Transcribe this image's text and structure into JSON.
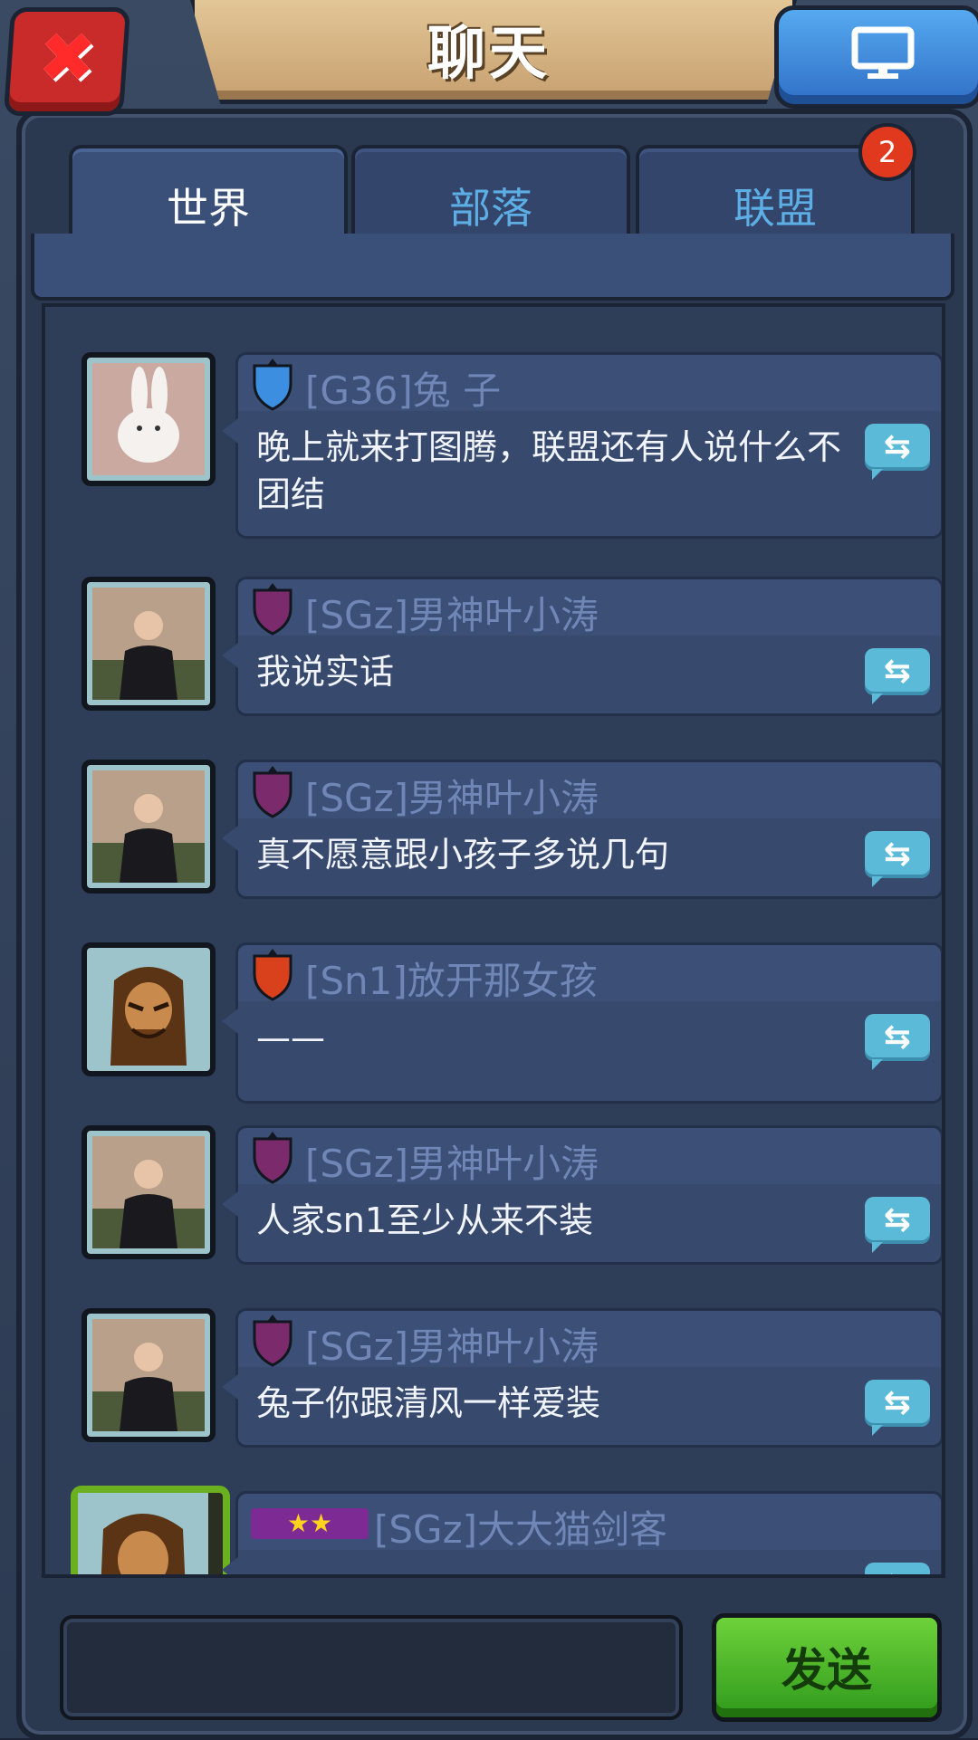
{
  "header": {
    "title": "聊天"
  },
  "tabs": [
    {
      "label": "世界"
    },
    {
      "label": "部落"
    },
    {
      "label": "联盟"
    }
  ],
  "badge_count": "2",
  "messages": [
    {
      "name": "[G36]兔 子",
      "text": "晚上就来打图腾，联盟还有人说什么不团结",
      "shield_color": "#3c8fe0",
      "avatar": "rabbit-avatar"
    },
    {
      "name": "[SGz]男神叶小涛",
      "text": "我说实话",
      "shield_color": "#7b2b6b",
      "avatar": "man-avatar"
    },
    {
      "name": "[SGz]男神叶小涛",
      "text": "真不愿意跟小孩子多说几句",
      "shield_color": "#7b2b6b",
      "avatar": "man-avatar"
    },
    {
      "name": "[Sn1]放开那女孩",
      "text": "——",
      "shield_color": "#d9411c",
      "avatar": "warrior-avatar"
    },
    {
      "name": "[SGz]男神叶小涛",
      "text": "人家sn1至少从来不装",
      "shield_color": "#7b2b6b",
      "avatar": "man-avatar"
    },
    {
      "name": "[SGz]男神叶小涛",
      "text": "兔子你跟清风一样爱装",
      "shield_color": "#7b2b6b",
      "avatar": "man-avatar"
    },
    {
      "name": "[SGz]大大猫剑客",
      "text": "",
      "avatar": "warrior-avatar"
    }
  ],
  "input": {
    "placeholder": ""
  },
  "send_label": "发送",
  "colors": {
    "accent_blue": "#5eaee6",
    "send_green": "#3fb124",
    "close_red": "#c92a2a",
    "banner_tan": "#d9b684"
  }
}
